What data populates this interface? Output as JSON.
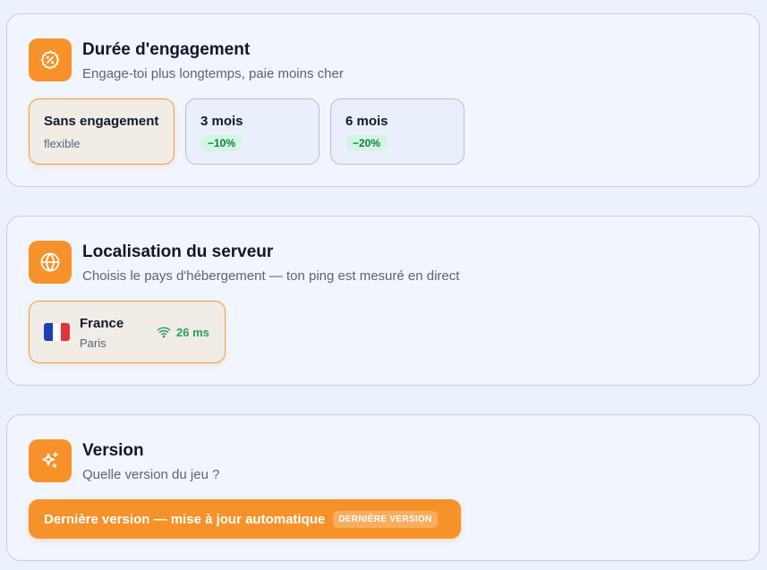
{
  "colors": {
    "accent": "#f7922a",
    "success": "#22a35c",
    "page_background": "#ecf2fc"
  },
  "engagement": {
    "icon": "badge-percent-icon",
    "title": "Durée d'engagement",
    "subtitle": "Engage-toi plus longtemps, paie moins cher",
    "options": [
      {
        "label": "Sans engagement",
        "hint": "flexible",
        "selected": true
      },
      {
        "label": "3 mois",
        "discount": "−10%",
        "selected": false
      },
      {
        "label": "6 mois",
        "discount": "−20%",
        "selected": false
      }
    ]
  },
  "location": {
    "icon": "globe-icon",
    "title": "Localisation du serveur",
    "subtitle": "Choisis le pays d'hébergement — ton ping est mesuré en direct",
    "servers": [
      {
        "country": "France",
        "city": "Paris",
        "ping": "26 ms",
        "flag_icon": "france-flag-icon",
        "selected": true
      }
    ]
  },
  "version": {
    "icon": "sparkles-icon",
    "title": "Version",
    "subtitle": "Quelle version du jeu ?",
    "option": {
      "label": "Dernière version — mise à jour automatique",
      "badge": "DERNIÈRE VERSION",
      "selected": true
    }
  }
}
